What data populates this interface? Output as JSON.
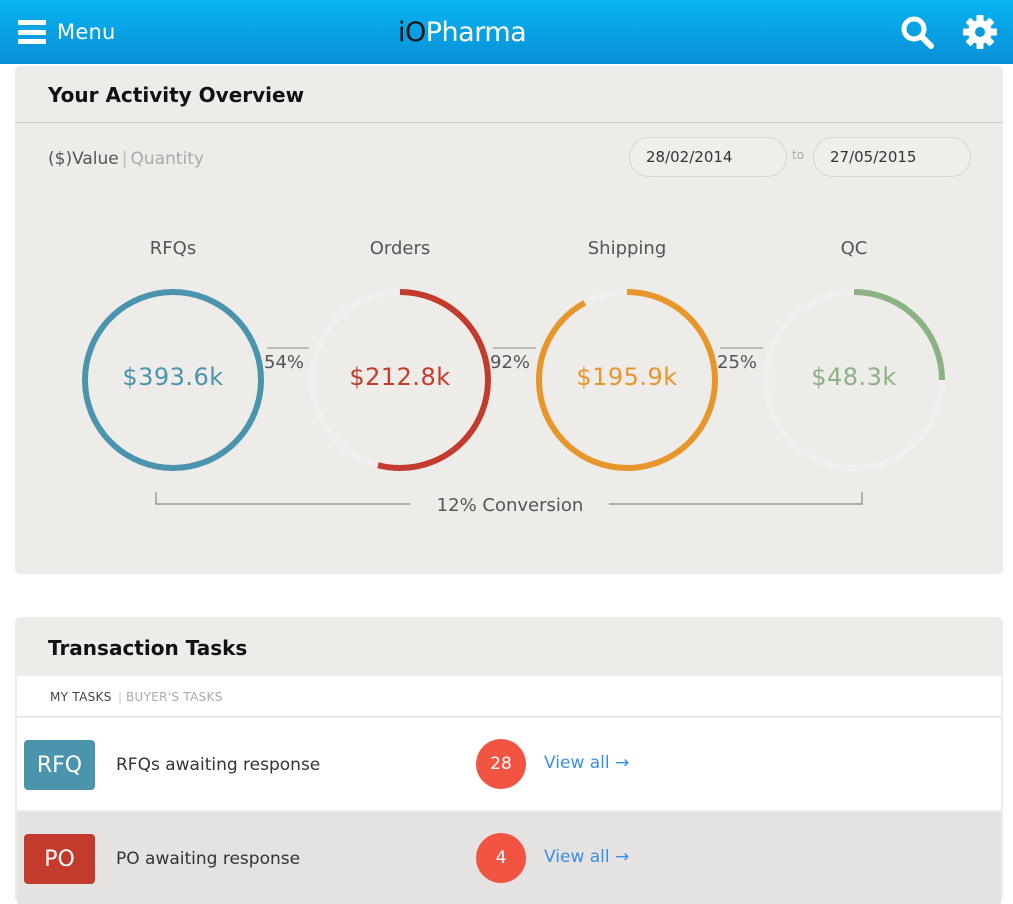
{
  "header": {
    "menu_label": "Menu",
    "brand_prefix": "iO",
    "brand_suffix": "Pharma"
  },
  "overview": {
    "title": "Your Activity Overview",
    "mode_value": "($)Value",
    "mode_separator": "|",
    "mode_quantity": "Quantity",
    "date_from": "28/02/2014",
    "date_separator": "to",
    "date_to": "27/05/2015",
    "stages": [
      {
        "label": "RFQs",
        "value": "$393.6k",
        "color": "#4a94ad",
        "fill": 1.0
      },
      {
        "label": "Orders",
        "value": "$212.8k",
        "color": "#c23b2c",
        "fill": 0.54
      },
      {
        "label": "Shipping",
        "value": "$195.9k",
        "color": "#e6962a",
        "fill": 0.92
      },
      {
        "label": "QC",
        "value": "$48.3k",
        "color": "#8cb184",
        "fill": 0.25
      }
    ],
    "conversions": [
      "54%",
      "92%",
      "25%"
    ],
    "total_conversion": "12% Conversion",
    "track_color": "#f1f0ee"
  },
  "tasks": {
    "title": "Transaction Tasks",
    "tab_my": "MY TASKS",
    "tab_separator": "|",
    "tab_buyer": "BUYER'S TASKS",
    "rows": [
      {
        "badge": "RFQ",
        "text": "RFQs awaiting response",
        "count": "28",
        "link": "View all →"
      },
      {
        "badge": "PO",
        "text": "PO awaiting response",
        "count": "4",
        "link": "View all →"
      }
    ]
  },
  "icons": {
    "menu": "hamburger-icon",
    "search": "search-icon",
    "settings": "gear-icon"
  }
}
